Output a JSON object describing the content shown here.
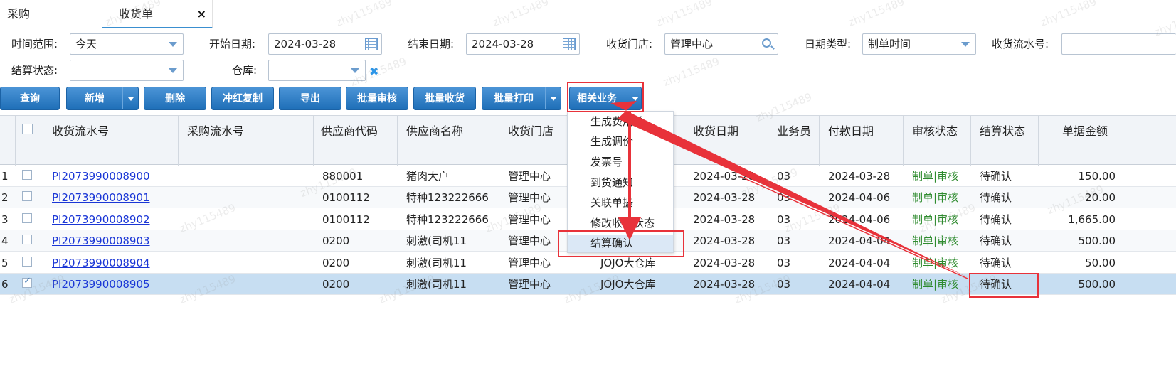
{
  "tabs": [
    {
      "label": "采购"
    },
    {
      "label": "收货单",
      "close": "×"
    }
  ],
  "filters": {
    "time_range": {
      "label": "时间范围:",
      "value": "今天"
    },
    "start_date": {
      "label": "开始日期:",
      "value": "2024-03-28"
    },
    "end_date": {
      "label": "结束日期:",
      "value": "2024-03-28"
    },
    "store": {
      "label": "收货门店:",
      "value": "管理中心"
    },
    "date_type": {
      "label": "日期类型:",
      "value": "制单时间"
    },
    "serial": {
      "label": "收货流水号:",
      "value": ""
    },
    "settle_status": {
      "label": "结算状态:",
      "value": ""
    },
    "warehouse": {
      "label": "仓库:",
      "value": "",
      "clear": "✖"
    }
  },
  "toolbar": {
    "query": "查询",
    "add": "新增",
    "delete": "删除",
    "red_copy": "冲红复制",
    "export": "导出",
    "batch_review": "批量审核",
    "batch_receive": "批量收货",
    "batch_print": "批量打印",
    "related": "相关业务"
  },
  "related_menu": [
    "生成费用单",
    "生成调价",
    "发票号",
    "到货通知",
    "关联单据",
    "修改收货状态",
    "结算确认"
  ],
  "columns": [
    "收货流水号",
    "采购流水号",
    "供应商代码",
    "供应商名称",
    "收货门店",
    "收货日期",
    "业务员",
    "付款日期",
    "审核状态",
    "结算状态",
    "单据金额"
  ],
  "rows": [
    {
      "no": "1",
      "serial": "PI2073990008900",
      "purchase": "",
      "supplier_code": "880001",
      "supplier_name": "猪肉大户",
      "store": "管理中心",
      "warehouse": "",
      "receive_date": "2024-03-28",
      "clerk": "03",
      "pay_date": "2024-03-28",
      "review": "制单|审核",
      "settle": "待确认",
      "amount": "150.00",
      "checked": false
    },
    {
      "no": "2",
      "serial": "PI2073990008901",
      "purchase": "",
      "supplier_code": "0100112",
      "supplier_name": "特种123222666",
      "store": "管理中心",
      "warehouse": "",
      "receive_date": "2024-03-28",
      "clerk": "03",
      "pay_date": "2024-04-06",
      "review": "制单|审核",
      "settle": "待确认",
      "amount": "20.00",
      "checked": false
    },
    {
      "no": "3",
      "serial": "PI2073990008902",
      "purchase": "",
      "supplier_code": "0100112",
      "supplier_name": "特种123222666",
      "store": "管理中心",
      "warehouse": "",
      "receive_date": "2024-03-28",
      "clerk": "03",
      "pay_date": "2024-04-06",
      "review": "制单|审核",
      "settle": "待确认",
      "amount": "1,665.00",
      "checked": false
    },
    {
      "no": "4",
      "serial": "PI2073990008903",
      "purchase": "",
      "supplier_code": "0200",
      "supplier_name": "刺激(司机11",
      "store": "管理中心",
      "warehouse": "",
      "receive_date": "2024-03-28",
      "clerk": "03",
      "pay_date": "2024-04-04",
      "review": "制单|审核",
      "settle": "待确认",
      "amount": "500.00",
      "checked": false
    },
    {
      "no": "5",
      "serial": "PI2073990008904",
      "purchase": "",
      "supplier_code": "0200",
      "supplier_name": "刺激(司机11",
      "store": "管理中心",
      "warehouse": "JOJO大仓库",
      "receive_date": "2024-03-28",
      "clerk": "03",
      "pay_date": "2024-04-04",
      "review": "制单|审核",
      "settle": "待确认",
      "amount": "50.00",
      "checked": false
    },
    {
      "no": "6",
      "serial": "PI2073990008905",
      "purchase": "",
      "supplier_code": "0200",
      "supplier_name": "刺激(司机11",
      "store": "管理中心",
      "warehouse": "JOJO大仓库",
      "receive_date": "2024-03-28",
      "clerk": "03",
      "pay_date": "2024-04-04",
      "review": "制单|审核",
      "settle": "待确认",
      "amount": "500.00",
      "checked": true
    }
  ],
  "watermark": "zhy115489",
  "colors": {
    "primary": "#2a7bc4",
    "link": "#1a36d6",
    "review_green": "#2e8b2e",
    "selected_row": "#c7def2",
    "annotation_red": "#e8323a"
  }
}
